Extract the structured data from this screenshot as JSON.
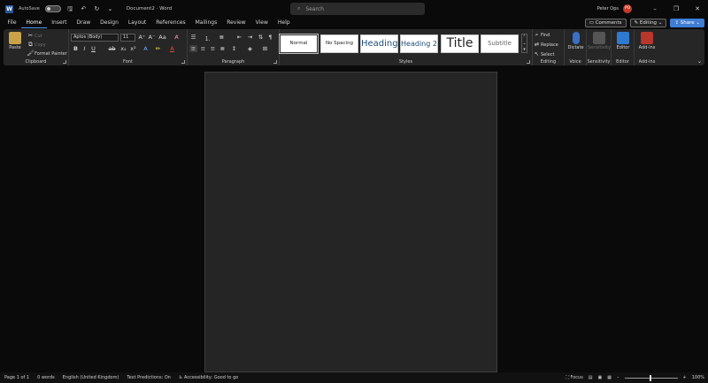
{
  "titlebar": {
    "autosave_label": "AutoSave",
    "autosave_state": "Off",
    "doc_title": "Document2  ·  Word",
    "search_placeholder": "Search",
    "username": "Peter Ops",
    "avatar_initials": "PO",
    "minimize_glyph": "–",
    "restore_glyph": "❐",
    "close_glyph": "✕"
  },
  "menubar": {
    "tabs": [
      "File",
      "Home",
      "Insert",
      "Draw",
      "Design",
      "Layout",
      "References",
      "Mailings",
      "Review",
      "View",
      "Help"
    ],
    "active": "Home",
    "comments_label": "Comments",
    "editing_label": "Editing",
    "share_label": "Share"
  },
  "ribbon": {
    "clipboard": {
      "label": "Clipboard",
      "paste": "Paste",
      "cut": "Cut",
      "copy": "Copy",
      "format_painter": "Format Painter"
    },
    "font": {
      "label": "Font",
      "font_name": "Aptos (Body)",
      "font_size": "11"
    },
    "paragraph": {
      "label": "Paragraph"
    },
    "styles": {
      "label": "Styles",
      "items": [
        "Normal",
        "No Spacing",
        "Heading",
        "Heading 2",
        "Title",
        "Subtitle"
      ]
    },
    "editing": {
      "label": "Editing",
      "find": "Find",
      "replace": "Replace",
      "select": "Select"
    },
    "voice": {
      "label": "Voice",
      "dictate": "Dictate"
    },
    "sensitivity": {
      "label": "Sensitivity",
      "button": "Sensitivity"
    },
    "editor": {
      "label": "Editor",
      "button": "Editor"
    },
    "addins": {
      "label": "Add-ins",
      "button": "Add-ins"
    }
  },
  "statusbar": {
    "page": "Page 1 of 1",
    "words": "0 words",
    "language": "English (United Kingdom)",
    "text_predictions": "Text Predictions: On",
    "accessibility": "Accessibility: Good to go",
    "focus": "Focus",
    "zoom": "100%"
  }
}
